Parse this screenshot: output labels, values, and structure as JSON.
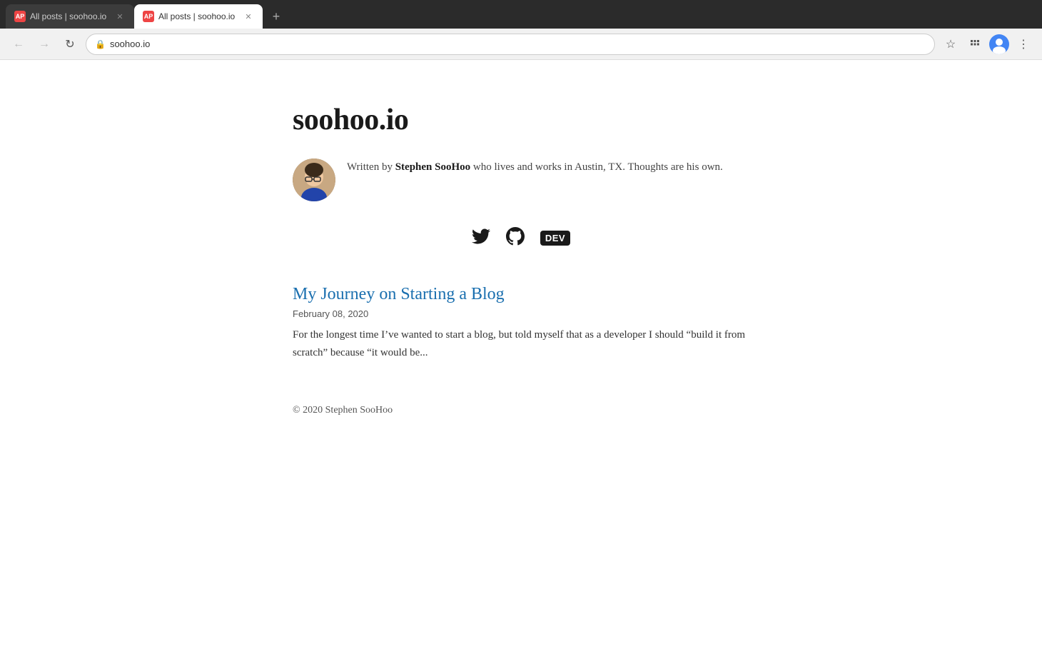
{
  "browser": {
    "tabs": [
      {
        "favicon": "AP",
        "title": "All posts | soohoo.io",
        "active": false
      },
      {
        "favicon": "AP",
        "title": "All posts | soohoo.io",
        "active": true
      }
    ],
    "address": "soohoo.io",
    "new_tab_label": "+"
  },
  "site": {
    "title": "soohoo.io",
    "author": {
      "bio_prefix": "Written by ",
      "name": "Stephen SooHoo",
      "bio_suffix": " who lives and works in Austin, TX. Thoughts are his own."
    },
    "social": {
      "twitter_label": "Twitter",
      "github_label": "GitHub",
      "dev_label": "DEV"
    },
    "posts": [
      {
        "title": "My Journey on Starting a Blog",
        "date": "February 08, 2020",
        "excerpt": "For the longest time I’ve wanted to start a blog, but told myself that as a developer I should “build it from scratch” because “it would be..."
      }
    ],
    "footer": {
      "copyright": "© 2020 Stephen SooHoo"
    }
  }
}
